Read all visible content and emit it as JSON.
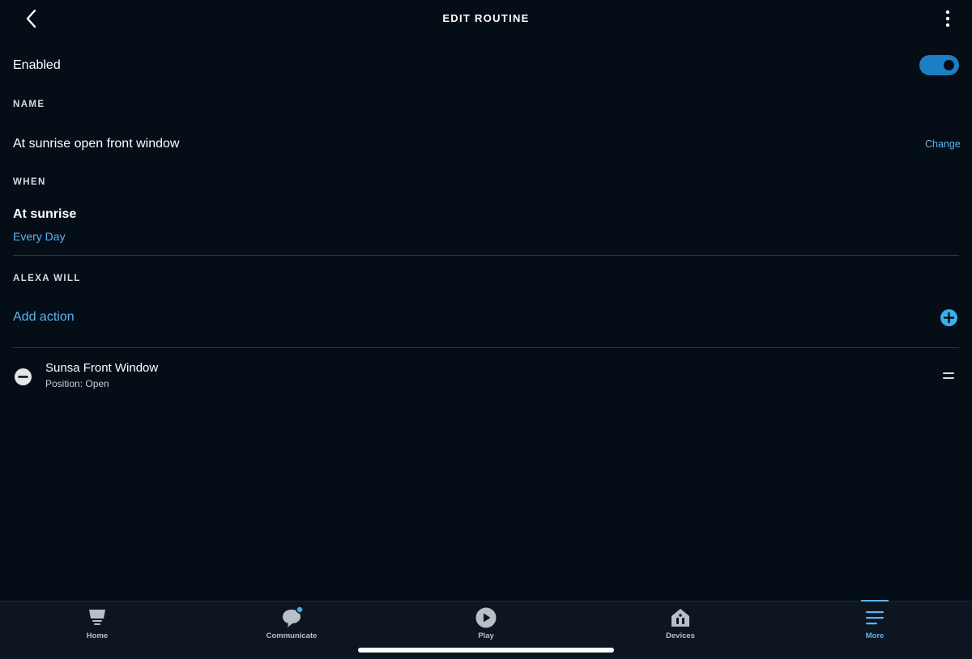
{
  "header": {
    "title": "EDIT ROUTINE",
    "back_icon": "chevron-left-icon",
    "more_icon": "vertical-ellipsis-icon"
  },
  "enabled": {
    "label": "Enabled",
    "state": true,
    "accent_color": "#1b7fc4"
  },
  "name_section": {
    "label": "NAME",
    "value": "At sunrise open front window",
    "change_label": "Change"
  },
  "when_section": {
    "label": "WHEN",
    "trigger": "At sunrise",
    "frequency": "Every Day"
  },
  "alexa_will_section": {
    "label": "ALEXA WILL",
    "add_action_label": "Add action",
    "actions": [
      {
        "name": "Sunsa Front Window",
        "detail": "Position: Open"
      }
    ]
  },
  "bottom_nav": {
    "items": [
      {
        "label": "Home",
        "icon": "home-icon"
      },
      {
        "label": "Communicate",
        "icon": "communicate-icon"
      },
      {
        "label": "Play",
        "icon": "play-icon"
      },
      {
        "label": "Devices",
        "icon": "devices-icon"
      },
      {
        "label": "More",
        "icon": "more-menu-icon"
      }
    ],
    "active": "More"
  },
  "colors": {
    "background": "#050d17",
    "link": "#5ab4f0",
    "notification_dot": "#3ab0e8"
  }
}
